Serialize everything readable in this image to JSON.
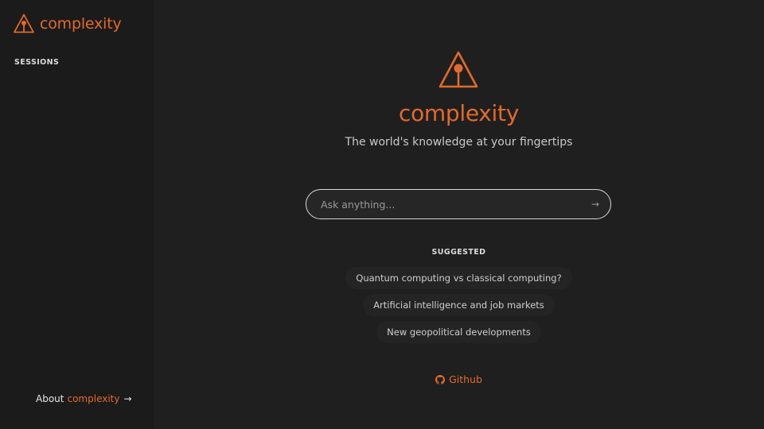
{
  "app": {
    "name": "complexity",
    "accent_color": "#e26a2c"
  },
  "sidebar": {
    "logo_icon": "triangle-pin-logo-icon",
    "sessions_label": "SESSIONS",
    "about": {
      "prefix": "About",
      "brand": "complexity",
      "arrow": "→"
    }
  },
  "main": {
    "title": "complexity",
    "tagline": "The world's knowledge at your fingertips",
    "search": {
      "placeholder": "Ask anything...",
      "value": "",
      "submit_icon": "arrow-right-icon",
      "submit_glyph": "→"
    },
    "suggested_label": "SUGGESTED",
    "suggestions": [
      "Quantum computing vs classical computing?",
      "Artificial intelligence and job markets",
      "New geopolitical developments"
    ],
    "github_label": "Github",
    "github_icon": "github-icon"
  }
}
